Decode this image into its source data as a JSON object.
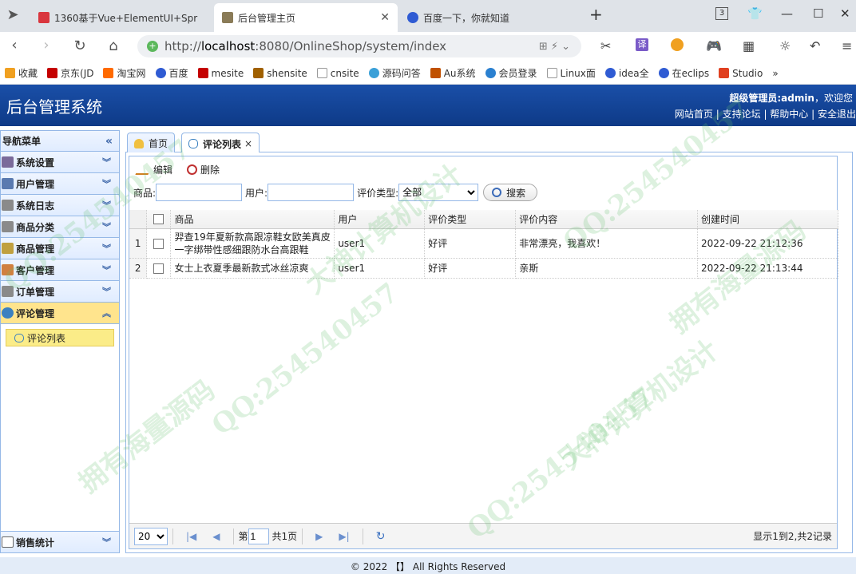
{
  "browser": {
    "tabs": [
      {
        "title": "1360基于Vue+ElementUI+Spr",
        "color": "#d9363e"
      },
      {
        "title": "后台管理主页",
        "color": "#8a7b57"
      },
      {
        "title": "百度一下，你就知道",
        "color": "#2f5bd3"
      }
    ],
    "new_tab": "+",
    "tab_count": "3",
    "url_prefix": "http://",
    "url_host": "localhost",
    "url_rest": ":8080/OnlineShop/system/index",
    "bookmarks": [
      {
        "label": "收藏",
        "color": "#f0a020"
      },
      {
        "label": "京东(JD",
        "color": "#c40000"
      },
      {
        "label": "淘宝网",
        "color": "#ff6a00"
      },
      {
        "label": "百度",
        "color": "#2f5bd3"
      },
      {
        "label": "mesite",
        "color": "#c40000"
      },
      {
        "label": "shensite",
        "color": "#a06000"
      },
      {
        "label": "cnsite",
        "color": "#999999"
      },
      {
        "label": "源码问答",
        "color": "#3aa0d8"
      },
      {
        "label": "Au系统",
        "color": "#c05000"
      },
      {
        "label": "会员登录",
        "color": "#2a80d0"
      },
      {
        "label": "Linux面",
        "color": "#999999"
      },
      {
        "label": "idea全",
        "color": "#2f5bd3"
      },
      {
        "label": "在eclips",
        "color": "#2f5bd3"
      },
      {
        "label": "Studio",
        "color": "#e04020"
      }
    ],
    "bookmarks_more": "»"
  },
  "app": {
    "title": "后台管理系统",
    "welcome_user": "超级管理员:admin",
    "welcome_suffix": "，欢迎您",
    "header_links": [
      "网站首页",
      "支持论坛",
      "帮助中心",
      "安全退出"
    ]
  },
  "sidebar": {
    "title": "导航菜单",
    "items": [
      {
        "label": "系统设置",
        "color": "#7a6a9a"
      },
      {
        "label": "用户管理",
        "color": "#5a7ab0"
      },
      {
        "label": "系统日志",
        "color": "#8a8a8a"
      },
      {
        "label": "商品分类",
        "color": "#8a8a8a"
      },
      {
        "label": "商品管理",
        "color": "#c0a040"
      },
      {
        "label": "客户管理",
        "color": "#d08040"
      },
      {
        "label": "订单管理",
        "color": "#8a8a8a"
      },
      {
        "label": "评论管理",
        "color": "#3a80c0"
      }
    ],
    "sub_item": "评论列表",
    "bottom_item": "销售统计"
  },
  "panel_tabs": [
    {
      "label": "首页"
    },
    {
      "label": "评论列表",
      "close": "×"
    }
  ],
  "toolbar": {
    "edit": "编辑",
    "delete": "删除"
  },
  "search": {
    "product_label": "商品:",
    "user_label": "用户:",
    "type_label": "评价类型:",
    "type_selected": "全部",
    "search_button": "搜索"
  },
  "table": {
    "columns": [
      "商品",
      "用户",
      "评价类型",
      "评价内容",
      "创建时间"
    ],
    "rows": [
      {
        "num": "1",
        "product": "羿查19年夏新款高跟凉鞋女欧美真皮一字绑带性感细跟防水台高跟鞋",
        "user": "user1",
        "type": "好评",
        "content": "非常漂亮，我喜欢！",
        "created": "2022-09-22 21:12:36"
      },
      {
        "num": "2",
        "product": "女士上衣夏季最新款式冰丝凉爽",
        "user": "user1",
        "type": "好评",
        "content": "亲斯",
        "created": "2022-09-22 21:13:44"
      }
    ]
  },
  "pager": {
    "page_size": "20",
    "page_prefix": "第",
    "page_value": "1",
    "page_suffix": "共1页",
    "info": "显示1到2,共2记录"
  },
  "footer": "© 2022 【】 All Rights Reserved",
  "watermark": [
    "QQ:254540457",
    "大神计算机设计",
    "拥有海量源码"
  ]
}
